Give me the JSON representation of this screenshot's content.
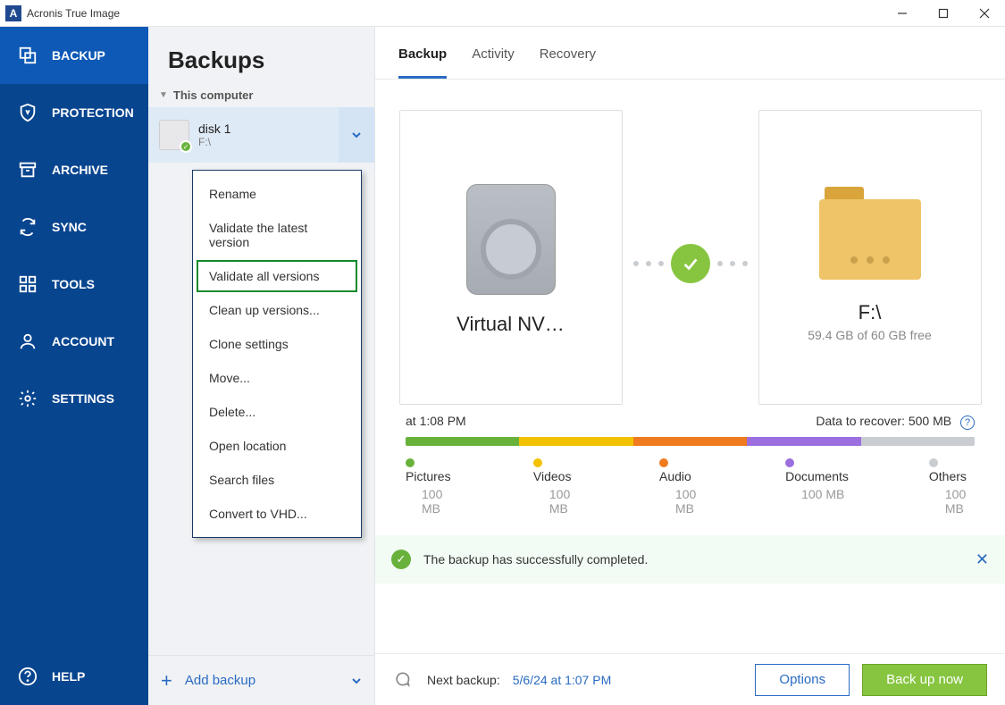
{
  "window": {
    "title": "Acronis True Image",
    "logo_letter": "A"
  },
  "nav": {
    "items": [
      {
        "id": "backup",
        "label": "BACKUP"
      },
      {
        "id": "protection",
        "label": "PROTECTION"
      },
      {
        "id": "archive",
        "label": "ARCHIVE"
      },
      {
        "id": "sync",
        "label": "SYNC"
      },
      {
        "id": "tools",
        "label": "TOOLS"
      },
      {
        "id": "account",
        "label": "ACCOUNT"
      },
      {
        "id": "settings",
        "label": "SETTINGS"
      }
    ],
    "help_label": "HELP"
  },
  "listpane": {
    "heading": "Backups",
    "accordion_label": "This computer",
    "backup": {
      "name": "disk 1",
      "location": "F:\\"
    },
    "add_label": "Add backup"
  },
  "context_menu": {
    "items": [
      "Rename",
      "Validate the latest version",
      "Validate all versions",
      "Clean up versions...",
      "Clone settings",
      "Move...",
      "Delete...",
      "Open location",
      "Search files",
      "Convert to VHD..."
    ],
    "highlighted_index": 2
  },
  "tabs": {
    "items": [
      "Backup",
      "Activity",
      "Recovery"
    ],
    "active_index": 0
  },
  "source_card": {
    "title": "Virtual NV…"
  },
  "dest_card": {
    "title": "F:\\",
    "subtitle": "59.4 GB of 60 GB free"
  },
  "status_row": {
    "left_suffix": "at 1:08 PM",
    "right_label": "Data to recover:",
    "right_value": "500 MB"
  },
  "stat_bar": {
    "segments": [
      {
        "color": "#68b23c",
        "flex": 1
      },
      {
        "color": "#f2c200",
        "flex": 1
      },
      {
        "color": "#f07a1e",
        "flex": 1
      },
      {
        "color": "#9c6fe0",
        "flex": 1
      },
      {
        "color": "#c9cdd2",
        "flex": 1
      }
    ]
  },
  "legend": {
    "items": [
      {
        "cls": "pictures",
        "name": "Pictures",
        "size": "100 MB"
      },
      {
        "cls": "videos",
        "name": "Videos",
        "size": "100 MB"
      },
      {
        "cls": "audio",
        "name": "Audio",
        "size": "100 MB"
      },
      {
        "cls": "documents",
        "name": "Documents",
        "size": "100 MB"
      },
      {
        "cls": "others",
        "name": "Others",
        "size": "100 MB"
      }
    ]
  },
  "banner": {
    "message": "The backup has successfully completed."
  },
  "footer": {
    "next_label": "Next backup:",
    "next_time": "5/6/24 at 1:07 PM",
    "options_label": "Options",
    "backup_label": "Back up now"
  }
}
